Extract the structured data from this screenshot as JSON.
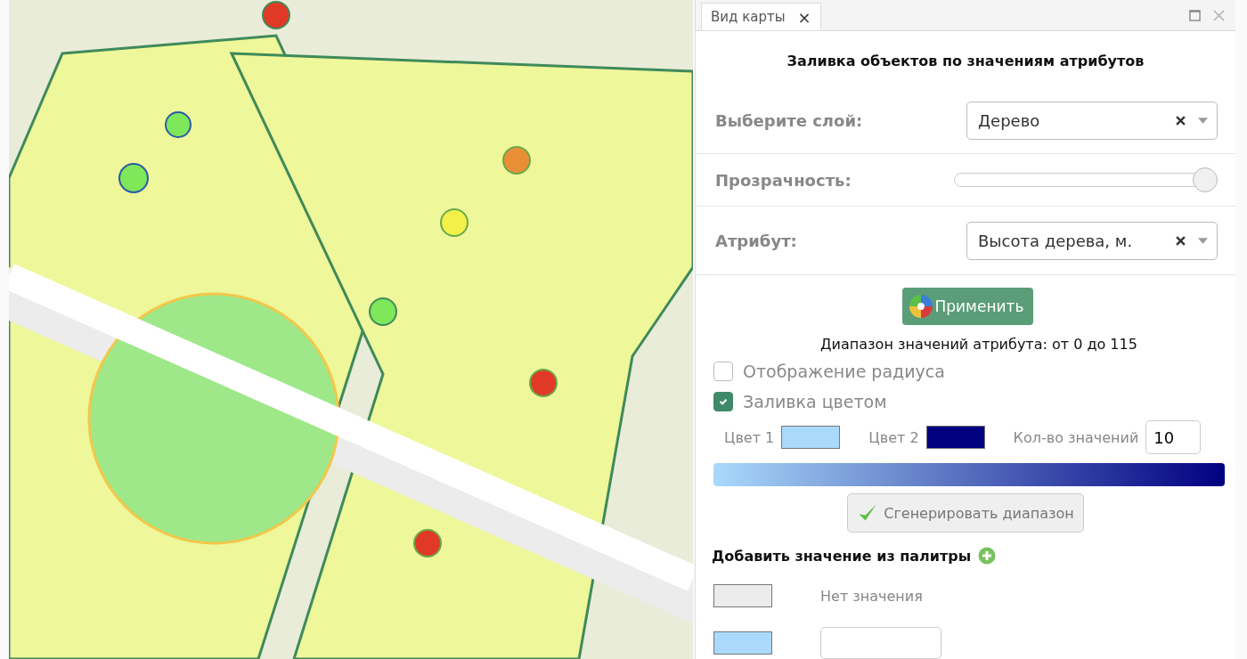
{
  "panel": {
    "tab": {
      "label": "Вид карты",
      "close": "×"
    },
    "title": "Заливка объектов по значениям атрибутов",
    "layer": {
      "label": "Выберите слой:",
      "value": "Дерево"
    },
    "opacity": {
      "label": "Прозрачность:",
      "level": 1.0
    },
    "attribute": {
      "label": "Атрибут:",
      "value": "Высота дерева, м."
    },
    "apply_button": "Применить",
    "range_text": "Диапазон значений атрибута: от 0 до 115",
    "checkboxes": [
      {
        "label": "Отображение радиуса",
        "checked": false
      },
      {
        "label": "Заливка цветом",
        "checked": true
      }
    ],
    "colors": [
      {
        "label": "Цвет 1",
        "color": "#aad9fb"
      },
      {
        "label": "Цвет 2",
        "color": "#000080"
      }
    ],
    "count": {
      "label": "Кол-во значений",
      "value": "10"
    },
    "generate_button": "Сгенерировать диапазон",
    "palette_heading": "Добавить значение из палитры",
    "legend": [
      {
        "kind": "none",
        "label": "Нет значения",
        "color": "#ececec"
      },
      {
        "kind": "value",
        "color": "#aad9fb"
      }
    ]
  }
}
